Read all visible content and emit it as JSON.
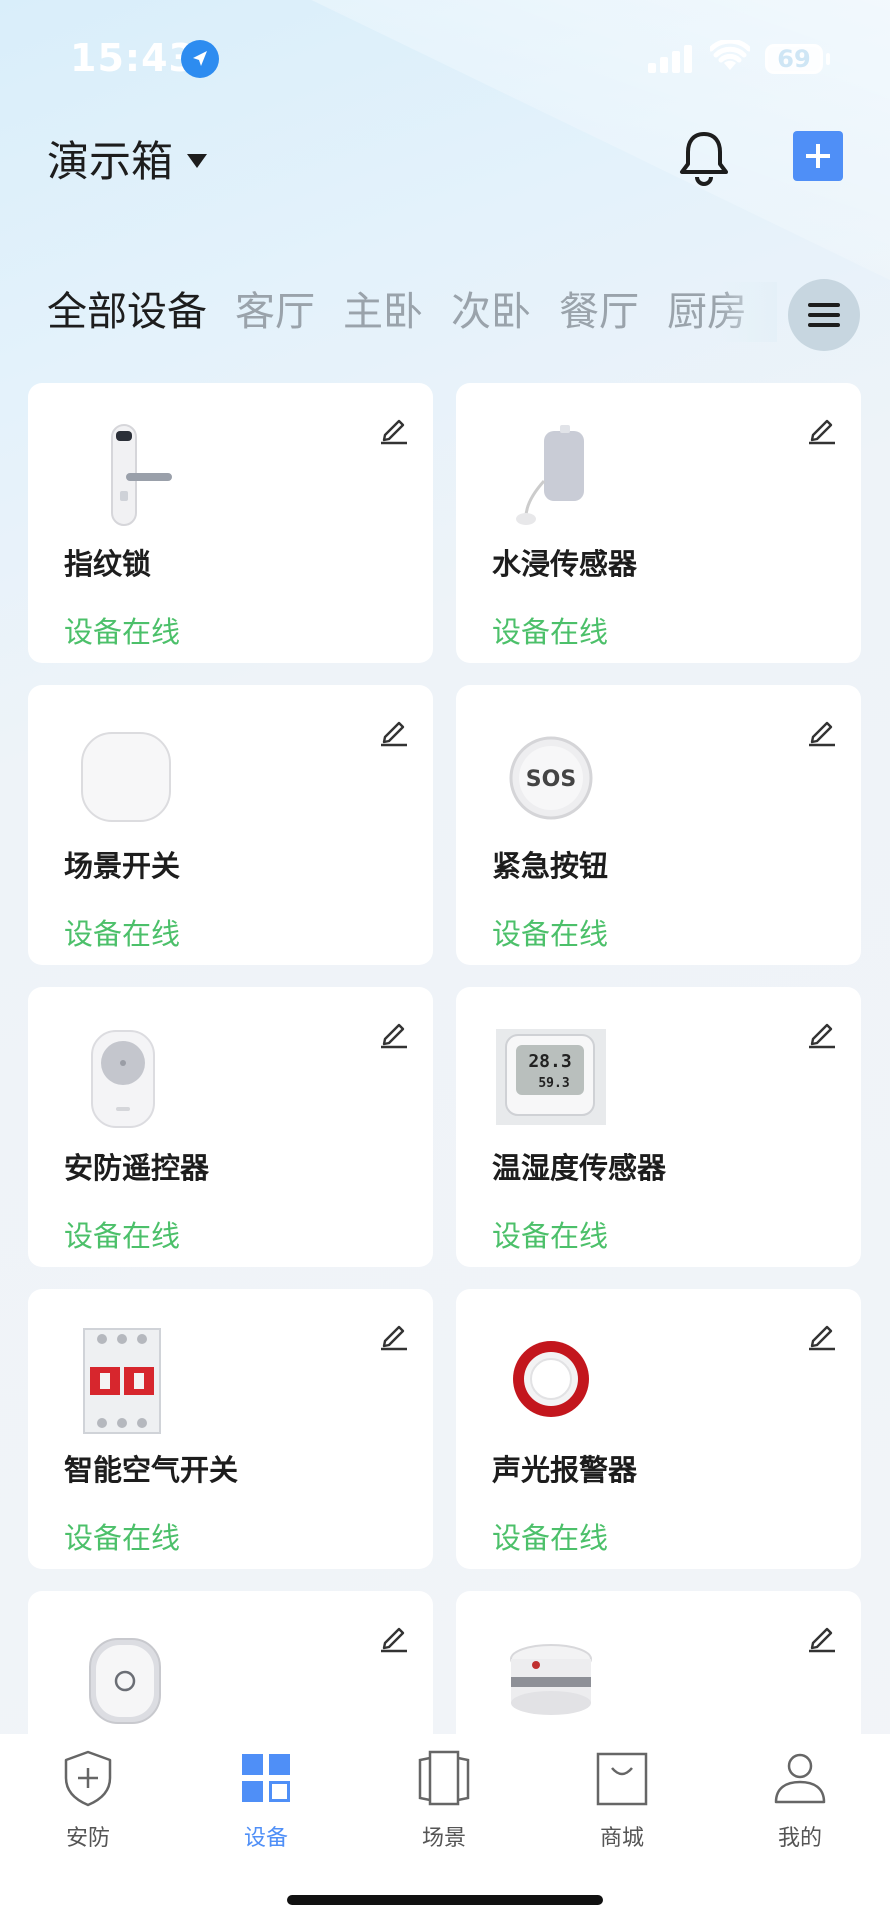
{
  "status_bar": {
    "time": "15:43",
    "battery": "69"
  },
  "header": {
    "home_name": "演示箱"
  },
  "tabs": [
    "全部设备",
    "客厅",
    "主卧",
    "次卧",
    "餐厅",
    "厨房"
  ],
  "devices": [
    {
      "name": "指纹锁",
      "status": "设备在线",
      "icon": "fingerprint-lock"
    },
    {
      "name": "水浸传感器",
      "status": "设备在线",
      "icon": "water-sensor"
    },
    {
      "name": "场景开关",
      "status": "设备在线",
      "icon": "scene-switch"
    },
    {
      "name": "紧急按钮",
      "status": "设备在线",
      "icon": "sos-button"
    },
    {
      "name": "安防遥控器",
      "status": "设备在线",
      "icon": "security-remote"
    },
    {
      "name": "温湿度传感器",
      "status": "设备在线",
      "icon": "thermo-hygrometer"
    },
    {
      "name": "智能空气开关",
      "status": "设备在线",
      "icon": "circuit-breaker"
    },
    {
      "name": "声光报警器",
      "status": "设备在线",
      "icon": "siren"
    },
    {
      "name": "",
      "status": "",
      "icon": "door-sensor"
    },
    {
      "name": "",
      "status": "",
      "icon": "smoke-detector"
    }
  ],
  "sensor_display": {
    "temp": "28.3",
    "humidity": "59.3"
  },
  "sos_label": "SOS",
  "tab_bar": [
    {
      "label": "安防",
      "icon": "shield-icon"
    },
    {
      "label": "设备",
      "icon": "grid-icon",
      "active": true
    },
    {
      "label": "场景",
      "icon": "scenes-icon"
    },
    {
      "label": "商城",
      "icon": "shopping-bag-icon"
    },
    {
      "label": "我的",
      "icon": "user-icon"
    }
  ],
  "colors": {
    "accent": "#4f8ff7",
    "online": "#4cc06a"
  }
}
